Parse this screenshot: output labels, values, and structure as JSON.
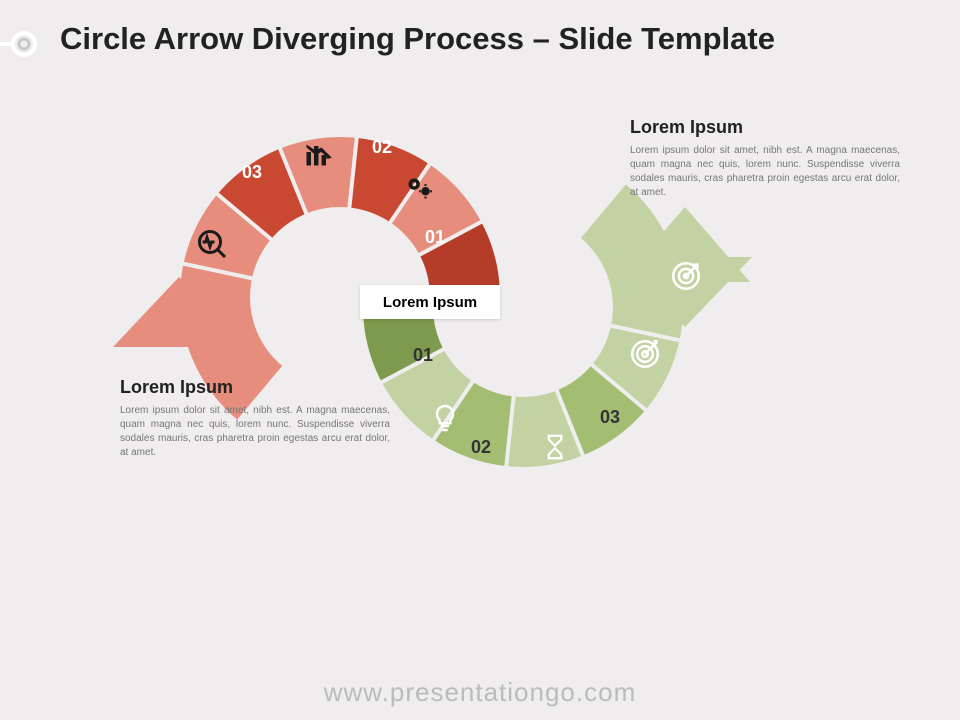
{
  "title": "Circle Arrow Diverging Process – Slide Template",
  "center_label": "Lorem Ipsum",
  "top_text": {
    "heading": "Lorem Ipsum",
    "body": "Lorem ipsum dolor sit amet, nibh est. A magna maecenas, quam magna nec quis, lorem nunc. Suspendisse viverra sodales mauris, cras pharetra proin egestas arcu erat dolor, at amet."
  },
  "bottom_text": {
    "heading": "Lorem Ipsum",
    "body": "Lorem ipsum dolor sit amet, nibh est. A magna maecenas, quam magna nec quis, lorem nunc. Suspendisse viverra sodales mauris, cras pharetra proin egestas arcu erat dolor, at amet."
  },
  "red_segments": [
    "01",
    "02",
    "03"
  ],
  "green_segments": [
    "01",
    "02",
    "03"
  ],
  "footer": "www.presentationgo.com",
  "colors": {
    "red_dark": "#b43c29",
    "red_mid": "#c84832",
    "red_light": "#e78d7e",
    "green_dark": "#7e9a4c",
    "green_mid": "#a3bd73",
    "green_light": "#c3d2a2"
  }
}
